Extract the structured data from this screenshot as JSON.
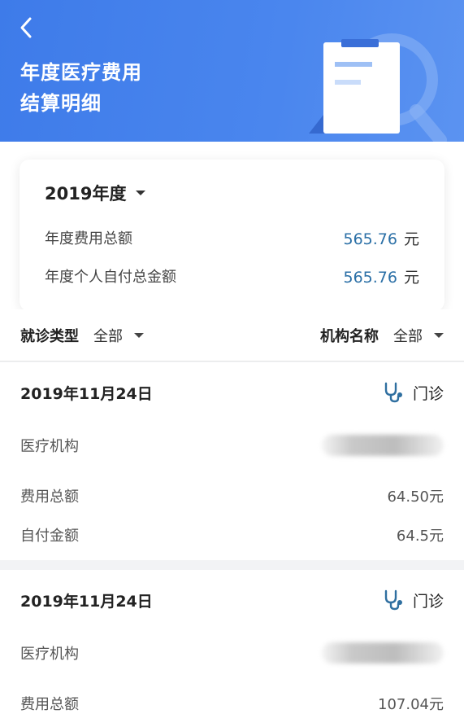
{
  "header": {
    "title_line1": "年度医疗费用",
    "title_line2": "结算明细"
  },
  "summary": {
    "year_label": "2019年度",
    "total_label": "年度费用总额",
    "total_value": "565.76",
    "total_unit": "元",
    "self_pay_label": "年度个人自付总金额",
    "self_pay_value": "565.76",
    "self_pay_unit": "元"
  },
  "filters": {
    "visit_type_label": "就诊类型",
    "visit_type_value": "全部",
    "institution_label": "机构名称",
    "institution_value": "全部"
  },
  "records": [
    {
      "date": "2019年11月24日",
      "visit_type": "门诊",
      "institution_label": "医疗机构",
      "total_label": "费用总额",
      "total_value": "64.50元",
      "self_pay_label": "自付金额",
      "self_pay_value": "64.5元"
    },
    {
      "date": "2019年11月24日",
      "visit_type": "门诊",
      "institution_label": "医疗机构",
      "total_label": "费用总额",
      "total_value": "107.04元"
    }
  ],
  "colors": {
    "header_blue": "#4a86ee",
    "amount_blue": "#2a6fa6",
    "icon_blue": "#2f6fa0"
  },
  "icons": {
    "back": "chevron-left-icon",
    "stethoscope": "stethoscope-icon"
  }
}
